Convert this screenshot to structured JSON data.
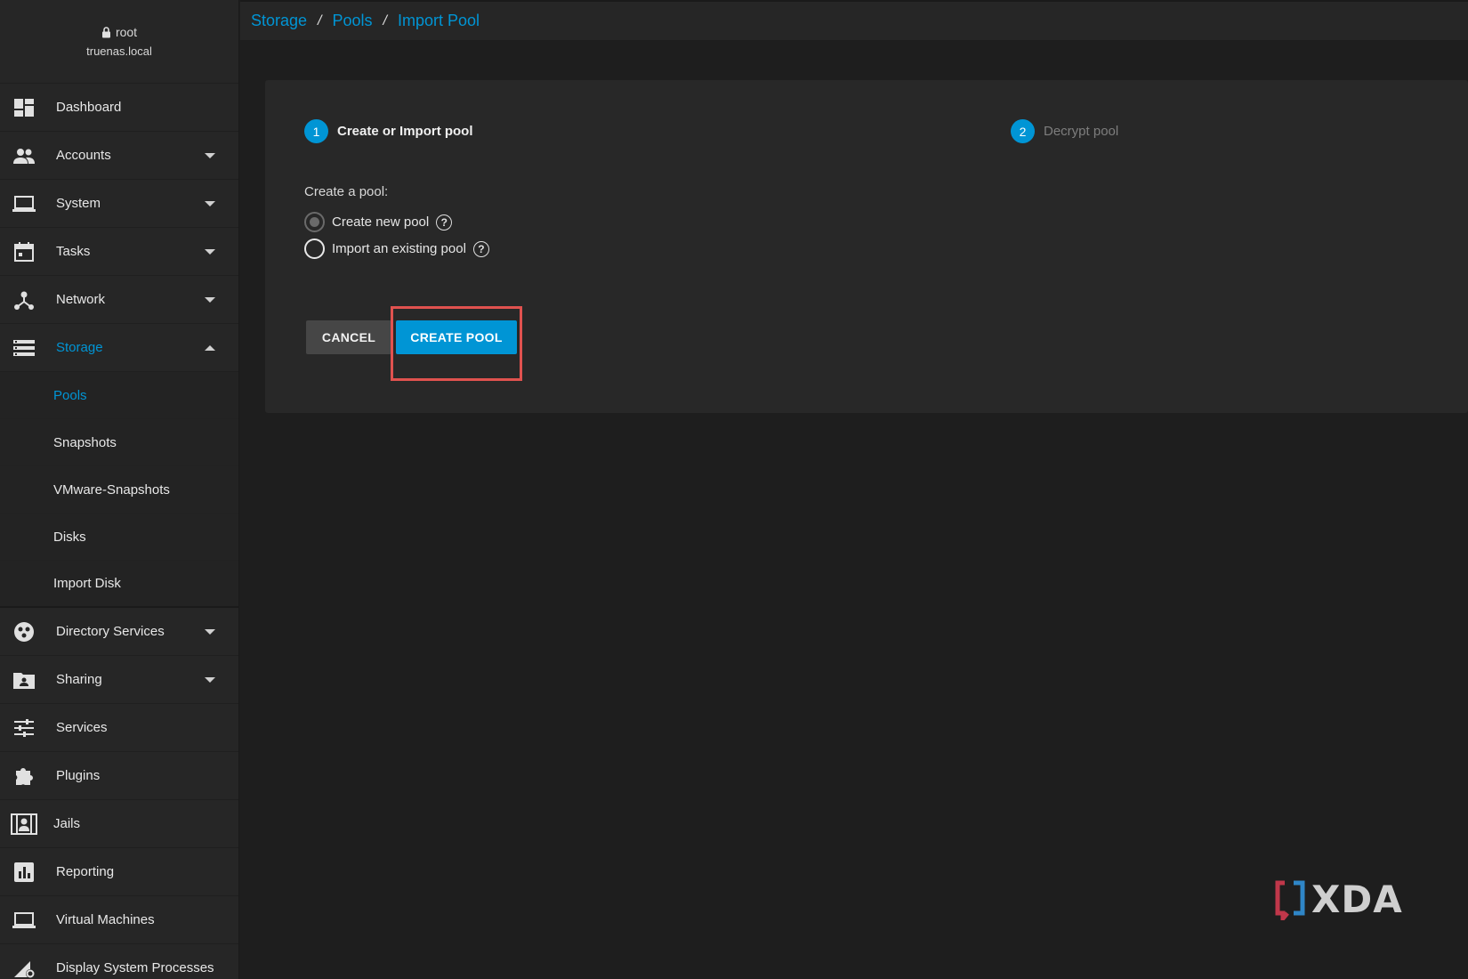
{
  "user": {
    "name": "root",
    "host": "truenas.local"
  },
  "breadcrumb": [
    "Storage",
    "Pools",
    "Import Pool"
  ],
  "nav": {
    "dashboard": "Dashboard",
    "accounts": "Accounts",
    "system": "System",
    "tasks": "Tasks",
    "network": "Network",
    "storage": "Storage",
    "storage_sub": [
      "Pools",
      "Snapshots",
      "VMware-Snapshots",
      "Disks",
      "Import Disk"
    ],
    "directory_services": "Directory Services",
    "sharing": "Sharing",
    "services": "Services",
    "plugins": "Plugins",
    "jails": "Jails",
    "reporting": "Reporting",
    "virtual_machines": "Virtual Machines",
    "display_system_processes": "Display System Processes"
  },
  "wizard": {
    "steps": [
      {
        "num": "1",
        "label": "Create or Import pool"
      },
      {
        "num": "2",
        "label": "Decrypt pool"
      }
    ],
    "section_label": "Create a pool:",
    "options": [
      "Create new pool",
      "Import an existing pool"
    ],
    "cancel_label": "CANCEL",
    "create_label": "CREATE POOL"
  },
  "watermark": "XDA",
  "colors": {
    "accent": "#0095d5",
    "highlight": "#e0524f",
    "background": "#1e1e1e",
    "sidebar": "#262626"
  }
}
